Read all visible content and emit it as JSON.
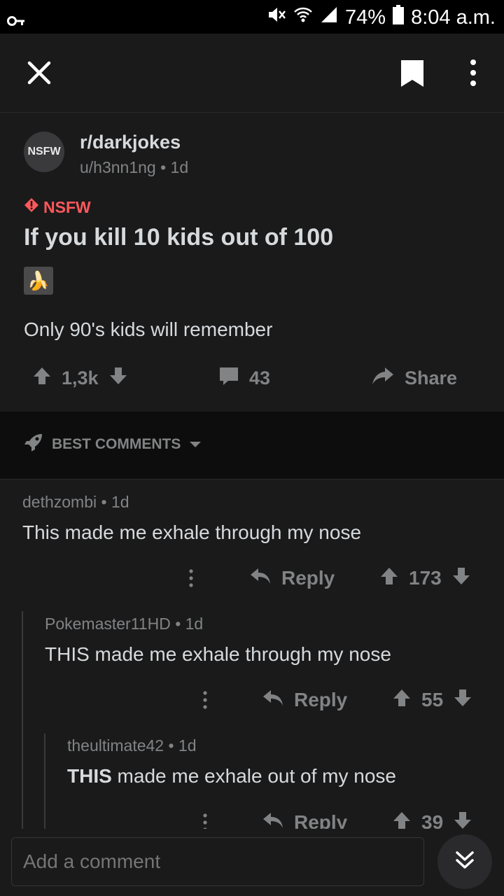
{
  "status_bar": {
    "battery": "74%",
    "time": "8:04 a.m."
  },
  "post": {
    "avatar_text": "NSFW",
    "subreddit": "r/darkjokes",
    "meta": "u/h3nn1ng • 1d",
    "nsfw_label": "NSFW",
    "title": "If you kill 10 kids out of 100",
    "flair_emoji": "🍌",
    "body": "Only 90's kids will remember",
    "votes": "1,3k",
    "comments": "43",
    "share": "Share"
  },
  "sort": {
    "label": "BEST COMMENTS"
  },
  "comments": [
    {
      "author": "dethzombi • 1d",
      "body": "This made me exhale through my nose",
      "reply": "Reply",
      "votes": "173"
    },
    {
      "author": "Pokemaster11HD • 1d",
      "body": "THIS made me exhale through my nose",
      "reply": "Reply",
      "votes": "55"
    },
    {
      "author": "theultimate42 • 1d",
      "body_bold": "THIS",
      "body_rest": " made me exhale out of my nose",
      "reply": "Reply",
      "votes": "39"
    }
  ],
  "composer": {
    "placeholder": "Add a comment"
  },
  "colors": {
    "background": "#1a1a1b",
    "nsfw_red": "#ff585b",
    "muted": "#818384"
  }
}
